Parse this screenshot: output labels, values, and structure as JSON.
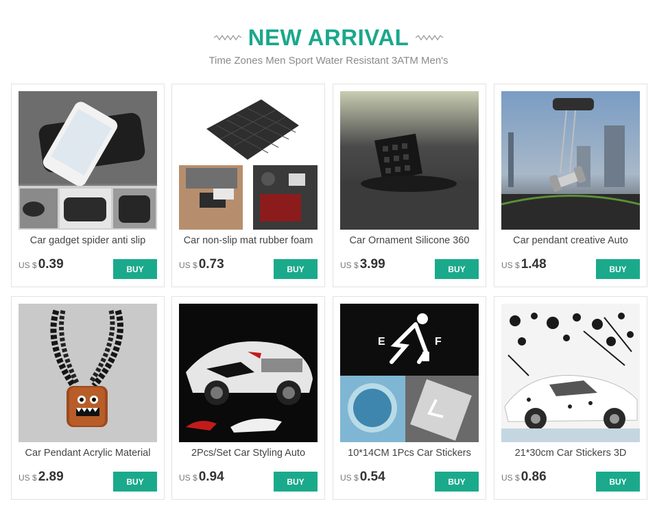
{
  "header": {
    "title": "NEW ARRIVAL",
    "subtitle": "Time Zones Men Sport Water Resistant 3ATM Men's"
  },
  "colors": {
    "accent": "#1aa88c",
    "buy_button": "#1aaa8b"
  },
  "products": [
    {
      "name": "Car gadget spider anti slip",
      "currency": "US $",
      "price": "0.39",
      "buy_label": "BUY"
    },
    {
      "name": "Car non-slip mat rubber foam",
      "currency": "US $",
      "price": "0.73",
      "buy_label": "BUY"
    },
    {
      "name": "Car Ornament Silicone 360",
      "currency": "US $",
      "price": "3.99",
      "buy_label": "BUY"
    },
    {
      "name": "Car pendant creative Auto",
      "currency": "US $",
      "price": "1.48",
      "buy_label": "BUY"
    },
    {
      "name": "Car Pendant Acrylic Material",
      "currency": "US $",
      "price": "2.89",
      "buy_label": "BUY"
    },
    {
      "name": "2Pcs/Set Car Styling Auto",
      "currency": "US $",
      "price": "0.94",
      "buy_label": "BUY"
    },
    {
      "name": "10*14CM 1Pcs Car Stickers",
      "currency": "US $",
      "price": "0.54",
      "buy_label": "BUY"
    },
    {
      "name": "21*30cm Car Stickers 3D",
      "currency": "US $",
      "price": "0.86",
      "buy_label": "BUY"
    }
  ]
}
